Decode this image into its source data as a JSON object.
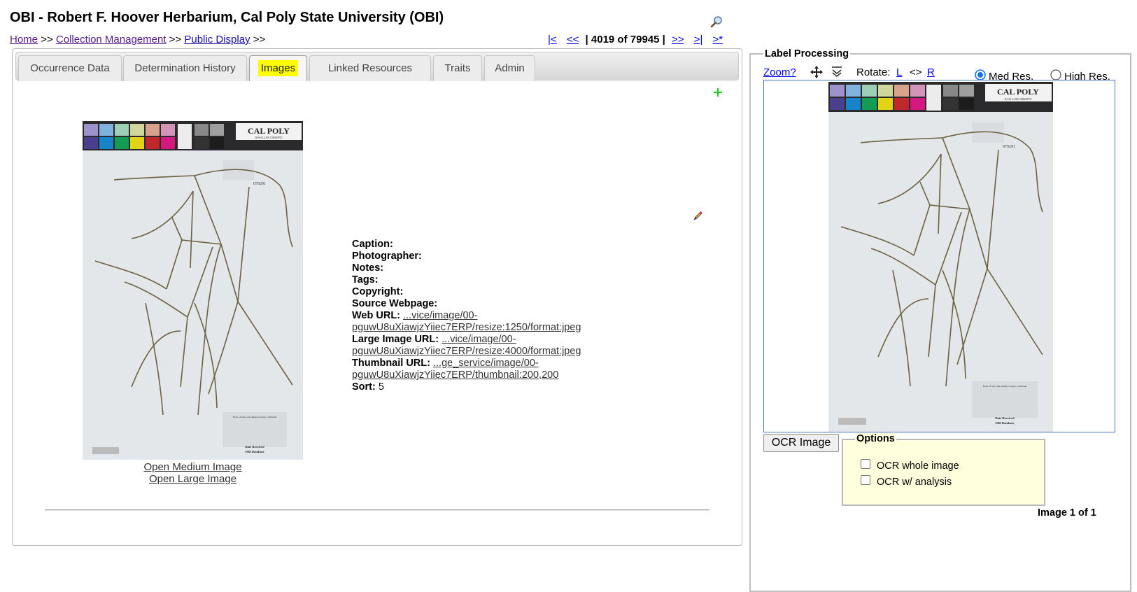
{
  "page": {
    "title": "OBI - Robert F. Hoover Herbarium, Cal Poly State University (OBI)"
  },
  "breadcrumb": {
    "home": "Home",
    "collection_management": "Collection Management",
    "public_display": "Public Display",
    "sep": ">>"
  },
  "pager": {
    "first": "|<",
    "prev": "<<",
    "position": "| 4019 of 79945 |",
    "next": ">>",
    "last": ">|",
    "new": ">*"
  },
  "tabs": [
    {
      "label": "Occurrence Data"
    },
    {
      "label": "Determination History"
    },
    {
      "label": "Images",
      "active": true
    },
    {
      "label": "Linked Resources"
    },
    {
      "label": "Traits"
    },
    {
      "label": "Admin"
    }
  ],
  "image_record": {
    "caption_label": "Caption:",
    "photographer_label": "Photographer:",
    "notes_label": "Notes:",
    "tags_label": "Tags:",
    "copyright_label": "Copyright:",
    "source_label": "Source Webpage:",
    "web_url_label": "Web URL:",
    "web_url_line1": "...vice/image/00-",
    "web_url_line2": "pguwU8uXiawjzYiiec7ERP/resize:1250/format:jpeg",
    "large_url_label": "Large Image URL:",
    "large_url_line1": "...vice/image/00-",
    "large_url_line2": "pguwU8uXiawjzYiiec7ERP/resize:4000/format:jpeg",
    "thumb_url_label": "Thumbnail URL:",
    "thumb_url_line1": "...ge_service/image/00-",
    "thumb_url_line2": "pguwU8uXiawjzYiiec7ERP/thumbnail:200,200",
    "sort_label": "Sort:",
    "sort_value": "5"
  },
  "image_links": {
    "open_medium": "Open Medium Image",
    "open_large": "Open Large Image"
  },
  "label_processing": {
    "legend": "Label Processing",
    "zoom": "Zoom?",
    "rotate_label": "Rotate:",
    "rotate_left": "L",
    "rotate_sep": "<>",
    "rotate_right": "R",
    "med_res": "Med Res.",
    "high_res": "High Res.",
    "ocr_button": "OCR Image",
    "options_legend": "Options",
    "ocr_whole": "OCR whole image",
    "ocr_analysis": "OCR w/ analysis",
    "image_count": "Image 1 of 1"
  },
  "specimen_sheet": {
    "logo_top": "CAL POLY",
    "logo_bottom": "SAN LUIS OBISPO",
    "accession": "079291",
    "label_title": "Flora of San Luis Obispo County, California",
    "stamp_line1": "Date Received",
    "stamp_line2": "OBI Database"
  },
  "colors": {
    "tab_highlight": "#ffff00",
    "add_icon": "#22cc22",
    "options_bg": "#ffffdd",
    "viewer_border": "#4a79c2"
  }
}
